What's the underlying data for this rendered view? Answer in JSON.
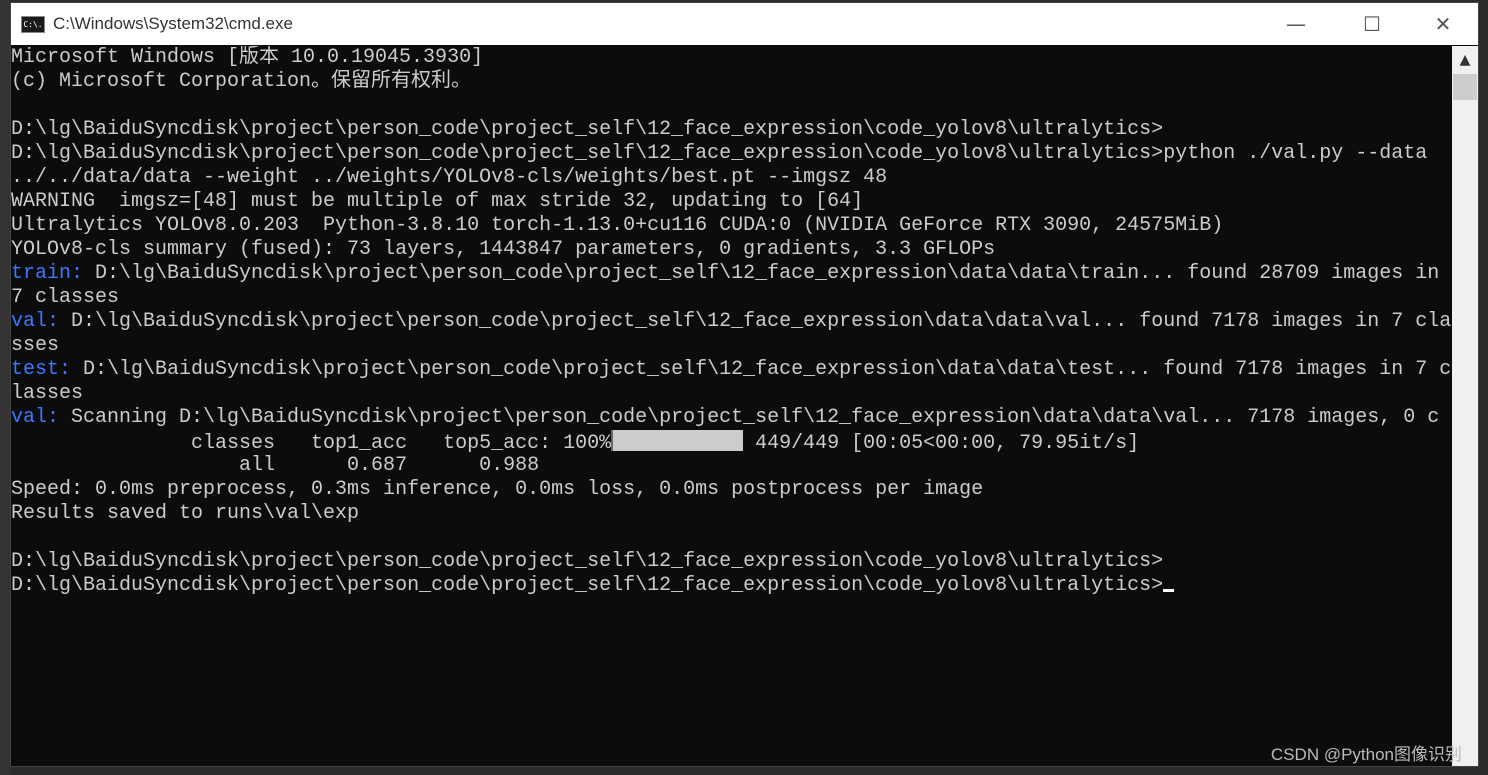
{
  "window": {
    "title": "C:\\Windows\\System32\\cmd.exe",
    "icon": "cmd-icon",
    "icon_text": "C:\\."
  },
  "controls": {
    "minimize": "—",
    "maximize": "☐",
    "close": "✕"
  },
  "terminal": {
    "lines": [
      {
        "label": "",
        "text": "Microsoft Windows [版本 10.0.19045.3930]"
      },
      {
        "label": "",
        "text": "(c) Microsoft Corporation。保留所有权利。"
      },
      {
        "label": "",
        "text": ""
      },
      {
        "label": "",
        "text": "D:\\lg\\BaiduSyncdisk\\project\\person_code\\project_self\\12_face_expression\\code_yolov8\\ultralytics>"
      },
      {
        "label": "",
        "text": "D:\\lg\\BaiduSyncdisk\\project\\person_code\\project_self\\12_face_expression\\code_yolov8\\ultralytics>python ./val.py --data"
      },
      {
        "label": "",
        "text": "../../data/data --weight ../weights/YOLOv8-cls/weights/best.pt --imgsz 48"
      },
      {
        "label": "",
        "text": "WARNING  imgsz=[48] must be multiple of max stride 32, updating to [64]"
      },
      {
        "label": "",
        "text": "Ultralytics YOLOv8.0.203  Python-3.8.10 torch-1.13.0+cu116 CUDA:0 (NVIDIA GeForce RTX 3090, 24575MiB)"
      },
      {
        "label": "",
        "text": "YOLOv8-cls summary (fused): 73 layers, 1443847 parameters, 0 gradients, 3.3 GFLOPs"
      },
      {
        "label": "train:",
        "text": " D:\\lg\\BaiduSyncdisk\\project\\person_code\\project_self\\12_face_expression\\data\\data\\train... found 28709 images in"
      },
      {
        "label": "",
        "text": "7 classes"
      },
      {
        "label": "val:",
        "text": " D:\\lg\\BaiduSyncdisk\\project\\person_code\\project_self\\12_face_expression\\data\\data\\val... found 7178 images in 7 cla"
      },
      {
        "label": "",
        "text": "sses"
      },
      {
        "label": "test:",
        "text": " D:\\lg\\BaiduSyncdisk\\project\\person_code\\project_self\\12_face_expression\\data\\data\\test... found 7178 images in 7 c"
      },
      {
        "label": "",
        "text": "lasses"
      },
      {
        "label": "val:",
        "text": " Scanning D:\\lg\\BaiduSyncdisk\\project\\person_code\\project_self\\12_face_expression\\data\\data\\val... 7178 images, 0 c"
      }
    ],
    "progress": {
      "prefix": "               classes   top1_acc   top5_acc: 100%",
      "percent": 100,
      "suffix": " 449/449 [00:05<00:00, 79.95it/s]"
    },
    "lines2": [
      {
        "text": "                   all      0.687      0.988"
      },
      {
        "text": "Speed: 0.0ms preprocess, 0.3ms inference, 0.0ms loss, 0.0ms postprocess per image"
      },
      {
        "text": "Results saved to runs\\val\\exp"
      },
      {
        "text": ""
      },
      {
        "text": "D:\\lg\\BaiduSyncdisk\\project\\person_code\\project_self\\12_face_expression\\code_yolov8\\ultralytics>"
      },
      {
        "text": "D:\\lg\\BaiduSyncdisk\\project\\person_code\\project_self\\12_face_expression\\code_yolov8\\ultralytics>"
      }
    ]
  },
  "colors": {
    "background": "#0c0c0c",
    "text": "#cccccc",
    "label": "#3b78ff"
  },
  "watermark": "CSDN @Python图像识别"
}
